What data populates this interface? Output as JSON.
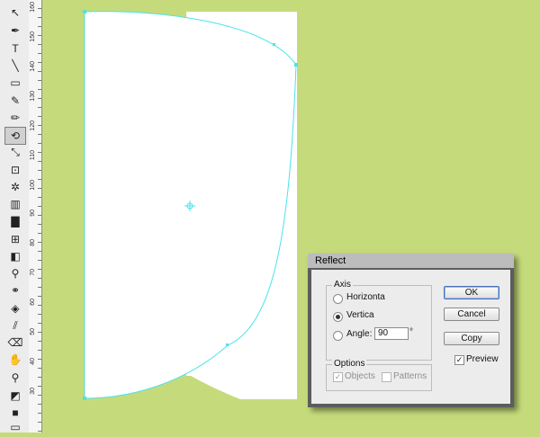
{
  "app": {
    "background_color": "#c5db7b",
    "path_color": "#4be3ea"
  },
  "ruler": {
    "labels": [
      "160",
      "150",
      "140",
      "130",
      "120",
      "110",
      "100",
      "90",
      "80",
      "70",
      "60",
      "50",
      "40",
      "30"
    ]
  },
  "toolbar": {
    "tools": [
      {
        "name": "direct-selection-tool-icon",
        "glyph": "↖"
      },
      {
        "name": "pen-tool-icon",
        "glyph": "✒"
      },
      {
        "name": "type-tool-icon",
        "glyph": "T"
      },
      {
        "name": "line-tool-icon",
        "glyph": "╲"
      },
      {
        "name": "rectangle-tool-icon",
        "glyph": "▭"
      },
      {
        "name": "paintbrush-tool-icon",
        "glyph": "✎"
      },
      {
        "name": "pencil-tool-icon",
        "glyph": "✏"
      },
      {
        "name": "reflect-tool-icon",
        "glyph": "⟲",
        "selected": true
      },
      {
        "name": "scale-tool-icon",
        "glyph": "⤡"
      },
      {
        "name": "free-transform-tool-icon",
        "glyph": "⊡"
      },
      {
        "name": "symbol-sprayer-tool-icon",
        "glyph": "✲"
      },
      {
        "name": "column-graph-tool-icon",
        "glyph": "▥"
      },
      {
        "name": "column-chart-tool-icon",
        "glyph": "▇"
      },
      {
        "name": "mesh-tool-icon",
        "glyph": "⊞"
      },
      {
        "name": "gradient-tool-icon",
        "glyph": "◧"
      },
      {
        "name": "eyedropper-tool-icon",
        "glyph": "⚲"
      },
      {
        "name": "blend-tool-icon",
        "glyph": "⚭"
      },
      {
        "name": "live-paint-bucket-icon",
        "glyph": "◈"
      },
      {
        "name": "slice-tool-icon",
        "glyph": "⫽"
      },
      {
        "name": "eraser-tool-icon",
        "glyph": "⌫"
      },
      {
        "name": "hand-tool-icon",
        "glyph": "✋"
      },
      {
        "name": "zoom-tool-icon",
        "glyph": "⚲"
      },
      {
        "name": "fill-stroke-swatch-icon",
        "glyph": "◩"
      },
      {
        "name": "color-mode-icon",
        "glyph": "■"
      },
      {
        "name": "screen-mode-icon",
        "glyph": "▭"
      }
    ]
  },
  "dialog": {
    "title": "Reflect",
    "axis": {
      "legend": "Axis",
      "horizontal_label": "Horizonta",
      "vertical_label": "Vertica",
      "angle_label": "Angle:",
      "angle_value": "90",
      "degree_symbol": "°",
      "selected": "vertical"
    },
    "options": {
      "legend": "Options",
      "objects_label": "Objects",
      "objects_checked": true,
      "patterns_label": "Patterns",
      "patterns_checked": false
    },
    "buttons": {
      "ok": "OK",
      "cancel": "Cancel",
      "copy": "Copy"
    },
    "preview": {
      "label": "Preview",
      "checked": true
    }
  }
}
